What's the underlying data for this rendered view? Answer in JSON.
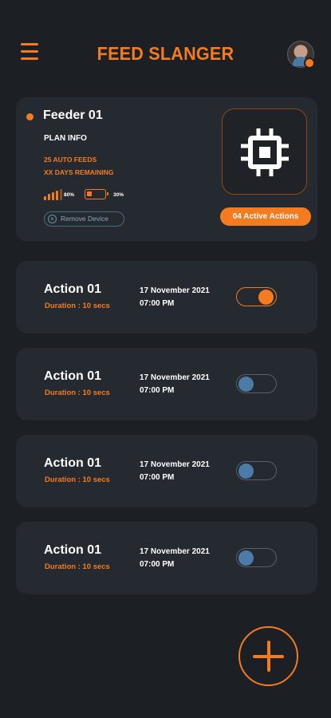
{
  "header": {
    "title": "FEED SLANGER",
    "menu_icon": "hamburger-menu-icon",
    "avatar_icon": "user-avatar"
  },
  "feeder": {
    "name": "Feeder 01",
    "plan_info": "PLAN INFO",
    "auto_feeds": "25 AUTO FEEDS",
    "days_remaining": "XX DAYS REMAINING",
    "signal": "80%",
    "battery": "30%",
    "battery_level": 0.3,
    "remove_label": "Remove Device",
    "active_actions": "04 Active Actions",
    "device_icon": "chip-icon",
    "accent_color": "#f47b20"
  },
  "actions": [
    {
      "title": "Action 01",
      "duration": "Duration : 10 secs",
      "date": "17 November 2021",
      "time": "07:00 PM",
      "enabled": true
    },
    {
      "title": "Action 01",
      "duration": "Duration : 10 secs",
      "date": "17 November 2021",
      "time": "07:00 PM",
      "enabled": false
    },
    {
      "title": "Action 01",
      "duration": "Duration : 10 secs",
      "date": "17 November 2021",
      "time": "07:00 PM",
      "enabled": false
    },
    {
      "title": "Action 01",
      "duration": "Duration : 10 secs",
      "date": "17 November 2021",
      "time": "07:00 PM",
      "enabled": false
    }
  ],
  "fab": {
    "icon": "plus-icon"
  }
}
